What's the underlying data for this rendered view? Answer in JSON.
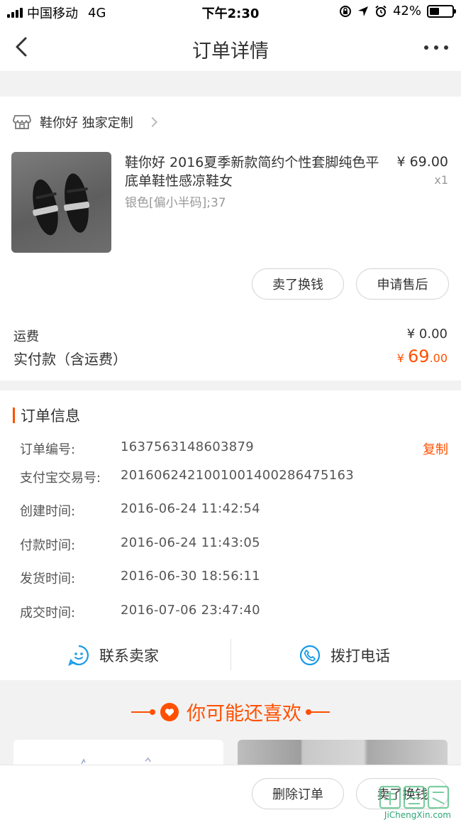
{
  "status_bar": {
    "carrier": "中国移动",
    "network": "4G",
    "time": "下午2:30",
    "battery": "42%",
    "battery_level": 0.42,
    "icons": [
      "orientation-lock-icon",
      "location-icon",
      "alarm-icon",
      "battery-icon"
    ]
  },
  "navbar": {
    "title": "订单详情",
    "back_icon": "back-icon",
    "more_icon": "more-icon"
  },
  "order": {
    "shop": {
      "icon": "shop-icon",
      "name": "鞋你好 独家定制"
    },
    "item": {
      "title": "鞋你好 2016夏季新款简约个性套脚纯色平底单鞋性感凉鞋女",
      "price": "¥ 69.00",
      "quantity": "x1",
      "sku": "银色[偏小半码];37"
    },
    "actions": [
      "卖了换钱",
      "申请售后"
    ],
    "shipping_label": "运费",
    "shipping_value": "¥ 0.00",
    "paid_label": "实付款（含运费）",
    "paid_currency": "¥ ",
    "paid_integer": "69",
    "paid_decimal": ".00"
  },
  "order_info": {
    "title": "订单信息",
    "copy_label": "复制",
    "rows": [
      {
        "label": "订单编号:",
        "value": "1637563148603879"
      },
      {
        "label": "支付宝交易号:",
        "value": "2016062421001001400286475163"
      },
      {
        "label": "创建时间:",
        "value": "2016-06-24 11:42:54"
      },
      {
        "label": "付款时间:",
        "value": "2016-06-24 11:43:05"
      },
      {
        "label": "发货时间:",
        "value": "2016-06-30 18:56:11"
      },
      {
        "label": "成交时间:",
        "value": "2016-07-06 23:47:40"
      }
    ]
  },
  "contact": {
    "seller": {
      "icon": "chat-icon",
      "label": "联系卖家"
    },
    "phone": {
      "icon": "phone-icon",
      "label": "拨打电话"
    }
  },
  "recommend": {
    "title": "你可能还喜欢",
    "icon": "heart-icon"
  },
  "bottom_bar": {
    "buttons": [
      "删除订单",
      "卖了换钱"
    ]
  },
  "watermark": {
    "text": "JiChengXin.com"
  },
  "colors": {
    "accent": "#ff5000",
    "link_blue": "#1a9be8",
    "background": "#f2f2f2",
    "text": "#333333",
    "muted": "#999999"
  }
}
